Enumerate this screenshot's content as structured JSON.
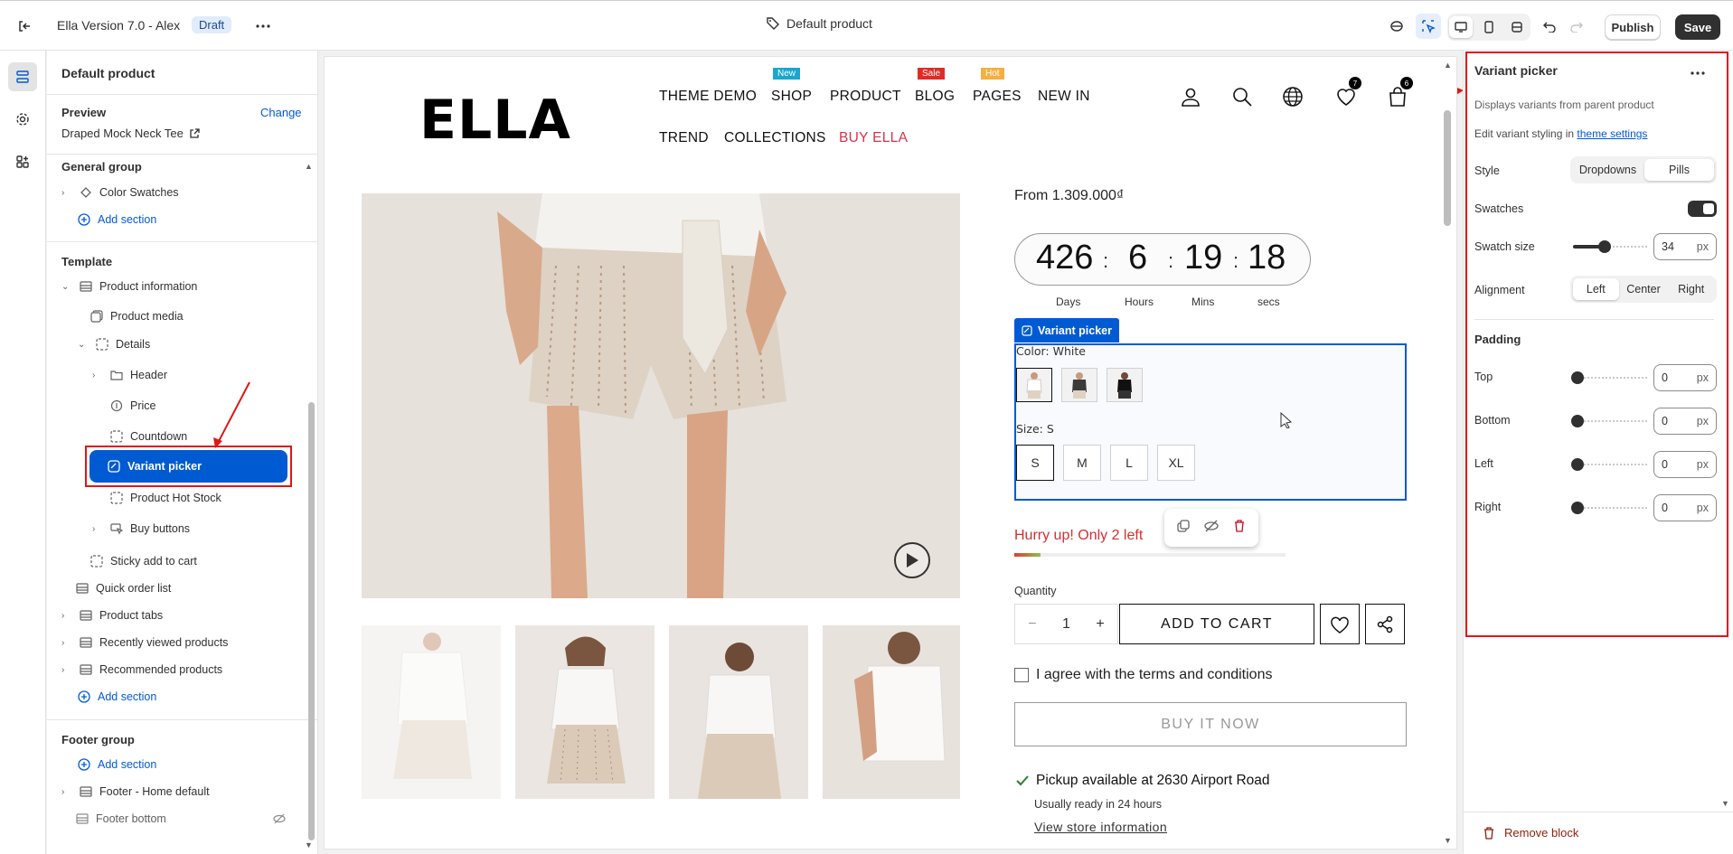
{
  "topbar": {
    "app_title": "Ella Version 7.0 - Alex",
    "status_badge": "Draft",
    "page_title": "Default product",
    "publish_label": "Publish",
    "save_label": "Save"
  },
  "left_panel": {
    "title": "Default product",
    "preview_label": "Preview",
    "change_label": "Change",
    "preview_value": "Draped Mock Neck Tee",
    "general_group": {
      "title": "General group",
      "items": [
        "Color Swatches"
      ],
      "add_section": "Add section"
    },
    "template": {
      "title": "Template",
      "product_information": "Product information",
      "product_media": "Product media",
      "details": "Details",
      "details_children": [
        "Header",
        "Price",
        "Countdown",
        "Variant picker",
        "Product Hot Stock",
        "Buy buttons"
      ],
      "sticky_add_to_cart": "Sticky add to cart",
      "sections": [
        "Quick order list",
        "Product tabs",
        "Recently viewed products",
        "Recommended products"
      ],
      "add_section": "Add section"
    },
    "footer_group": {
      "title": "Footer group",
      "add_section": "Add section",
      "items": [
        "Footer - Home default",
        "Footer bottom"
      ]
    }
  },
  "storefront": {
    "logo": "ELLA",
    "nav_row1": [
      "THEME DEMO",
      "SHOP",
      "PRODUCT",
      "BLOG",
      "PAGES",
      "NEW IN"
    ],
    "nav_row2": [
      "TREND",
      "COLLECTIONS",
      "BUY ELLA"
    ],
    "nav_badges": {
      "shop": "New",
      "blog": "Sale",
      "pages": "Hot"
    },
    "badge_colors": {
      "new": "#19a7ce",
      "sale": "#e02b27",
      "hot": "#f5b041",
      "buy_ella": "#d6334c"
    },
    "wishlist_count": "7",
    "cart_count": "6",
    "price": "From 1.309.000₫",
    "countdown": {
      "days": "426",
      "hours": "6",
      "mins": "19",
      "secs": "18",
      "labels": [
        "Days",
        "Hours",
        "Mins",
        "secs"
      ]
    },
    "variant_picker_tag": "Variant picker",
    "color_label": "Color: White",
    "size_label": "Size: S",
    "sizes": [
      "S",
      "M",
      "L",
      "XL"
    ],
    "hurry_text": "Hurry up! Only 2 left",
    "quantity_label": "Quantity",
    "quantity_value": "1",
    "add_to_cart": "ADD TO CART",
    "agree_text": "I agree with the terms and conditions",
    "buy_now": "BUY IT NOW",
    "pickup_text": "Pickup available at 2630 Airport Road",
    "ready_text": "Usually ready in 24 hours",
    "store_info": "View store information"
  },
  "right_panel": {
    "title": "Variant picker",
    "description": "Displays variants from parent product",
    "edit_prefix": "Edit variant styling in ",
    "edit_link": "theme settings",
    "style_label": "Style",
    "style_options": [
      "Dropdowns",
      "Pills"
    ],
    "swatches_label": "Swatches",
    "swatch_size_label": "Swatch size",
    "swatch_size_value": "34",
    "unit": "px",
    "alignment_label": "Alignment",
    "alignment_options": [
      "Left",
      "Center",
      "Right"
    ],
    "padding_title": "Padding",
    "padding": [
      {
        "label": "Top",
        "value": "0"
      },
      {
        "label": "Bottom",
        "value": "0"
      },
      {
        "label": "Left",
        "value": "0"
      },
      {
        "label": "Right",
        "value": "0"
      }
    ],
    "remove_label": "Remove block"
  }
}
